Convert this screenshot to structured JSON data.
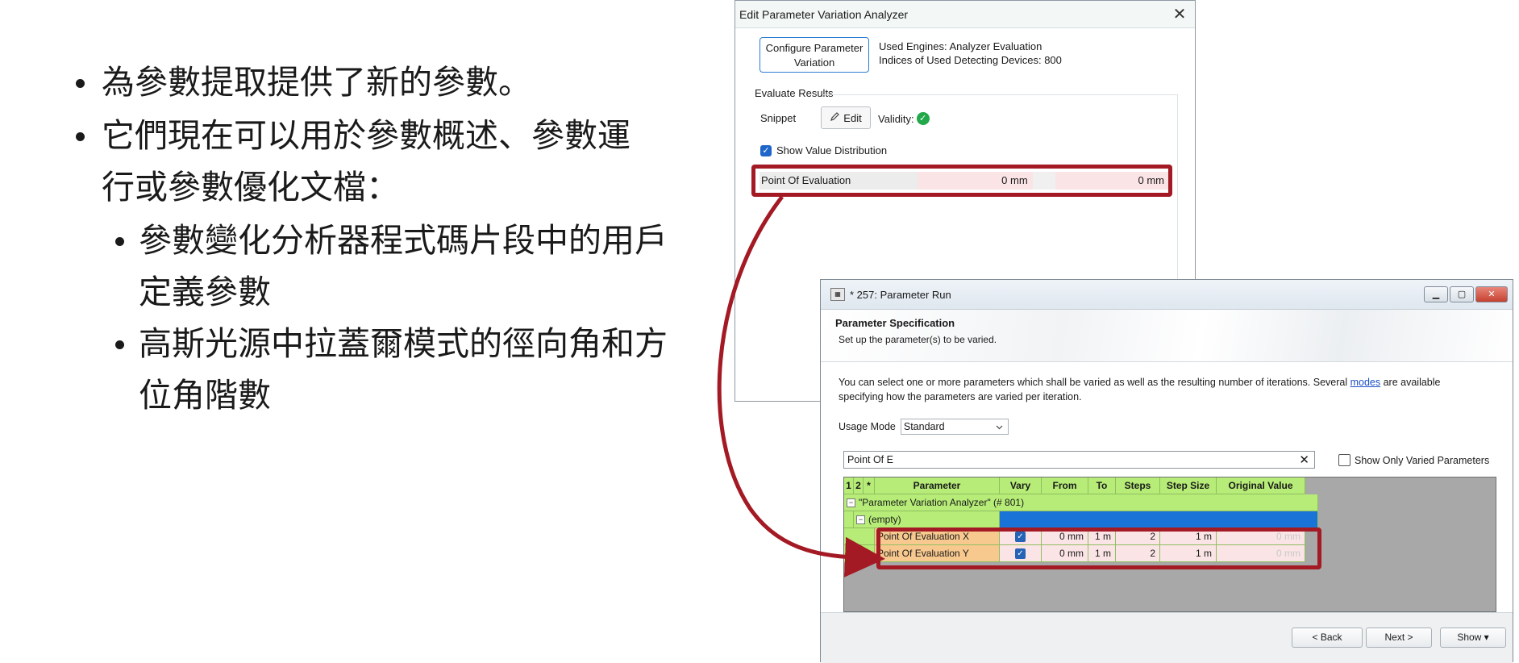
{
  "slide": {
    "bullets": [
      "為參數提取提供了新的參數。",
      "它們現在可以用於參數概述、參數運行或參數優化文檔："
    ],
    "bullet2_line1": "它們現在可以用於參數概述、參數運",
    "bullet2_line2": "行或參數優化文檔：",
    "sub_bullets": [
      {
        "line1": "參數變化分析器程式碼片段中的用戶",
        "line2": "定義參數"
      },
      {
        "line1": "高斯光源中拉蓋爾模式的徑向角和方",
        "line2": "位角階數"
      }
    ]
  },
  "analyzer_dialog": {
    "title": "Edit Parameter Variation Analyzer",
    "close_glyph": "✕",
    "configure_button_line1": "Configure Parameter",
    "configure_button_line2": "Variation",
    "used_engines": "Used Engines: Analyzer Evaluation",
    "indices_devices": "Indices of Used Detecting Devices: 800",
    "evaluate_results_label": "Evaluate Results",
    "snippet_label": "Snippet",
    "edit_button": "Edit",
    "validity_label": "Validity:",
    "show_value_distribution": "Show Value Distribution",
    "show_value_distribution_checked": true,
    "point_of_evaluation_label": "Point Of Evaluation",
    "point_of_evaluation_x": "0 mm",
    "point_of_evaluation_y": "0 mm"
  },
  "run_window": {
    "title": "* 257: Parameter Run",
    "section_title": "Parameter Specification",
    "section_subtitle": "Set up the parameter(s) to be varied.",
    "description_before_link": "You can select one or more parameters which shall be varied as well as the resulting number of iterations. Several ",
    "description_link": "modes",
    "description_after_link": " are available specifying how the parameters are varied per iteration.",
    "usage_mode_label": "Usage Mode",
    "usage_mode_value": "Standard",
    "search_value": "Point Of E",
    "search_clear_glyph": "✕",
    "show_only_varied_label": "Show Only Varied Parameters",
    "show_only_varied_checked": false,
    "table": {
      "headers": [
        "1",
        "2",
        "*",
        "Parameter",
        "Vary",
        "From",
        "To",
        "Steps",
        "Step Size",
        "Original Value"
      ],
      "group_row": "\"Parameter Variation Analyzer\" (# 801)",
      "subgroup_row": "(empty)",
      "rows": [
        {
          "parameter": "Point Of Evaluation X",
          "vary": true,
          "from": "0 mm",
          "to": "1 m",
          "steps": "2",
          "step_size": "1 m",
          "original_value": "0 mm"
        },
        {
          "parameter": "Point Of Evaluation Y",
          "vary": true,
          "from": "0 mm",
          "to": "1 m",
          "steps": "2",
          "step_size": "1 m",
          "original_value": "0 mm"
        }
      ]
    },
    "buttons": {
      "back": "< Back",
      "next": "Next >",
      "show": "Show ▾"
    }
  },
  "colors": {
    "highlight": "#a31924",
    "grid_header": "#b6ec77",
    "param_cell": "#f8c98f",
    "selection_blue": "#1a73d6",
    "valid_green": "#22a84a"
  }
}
